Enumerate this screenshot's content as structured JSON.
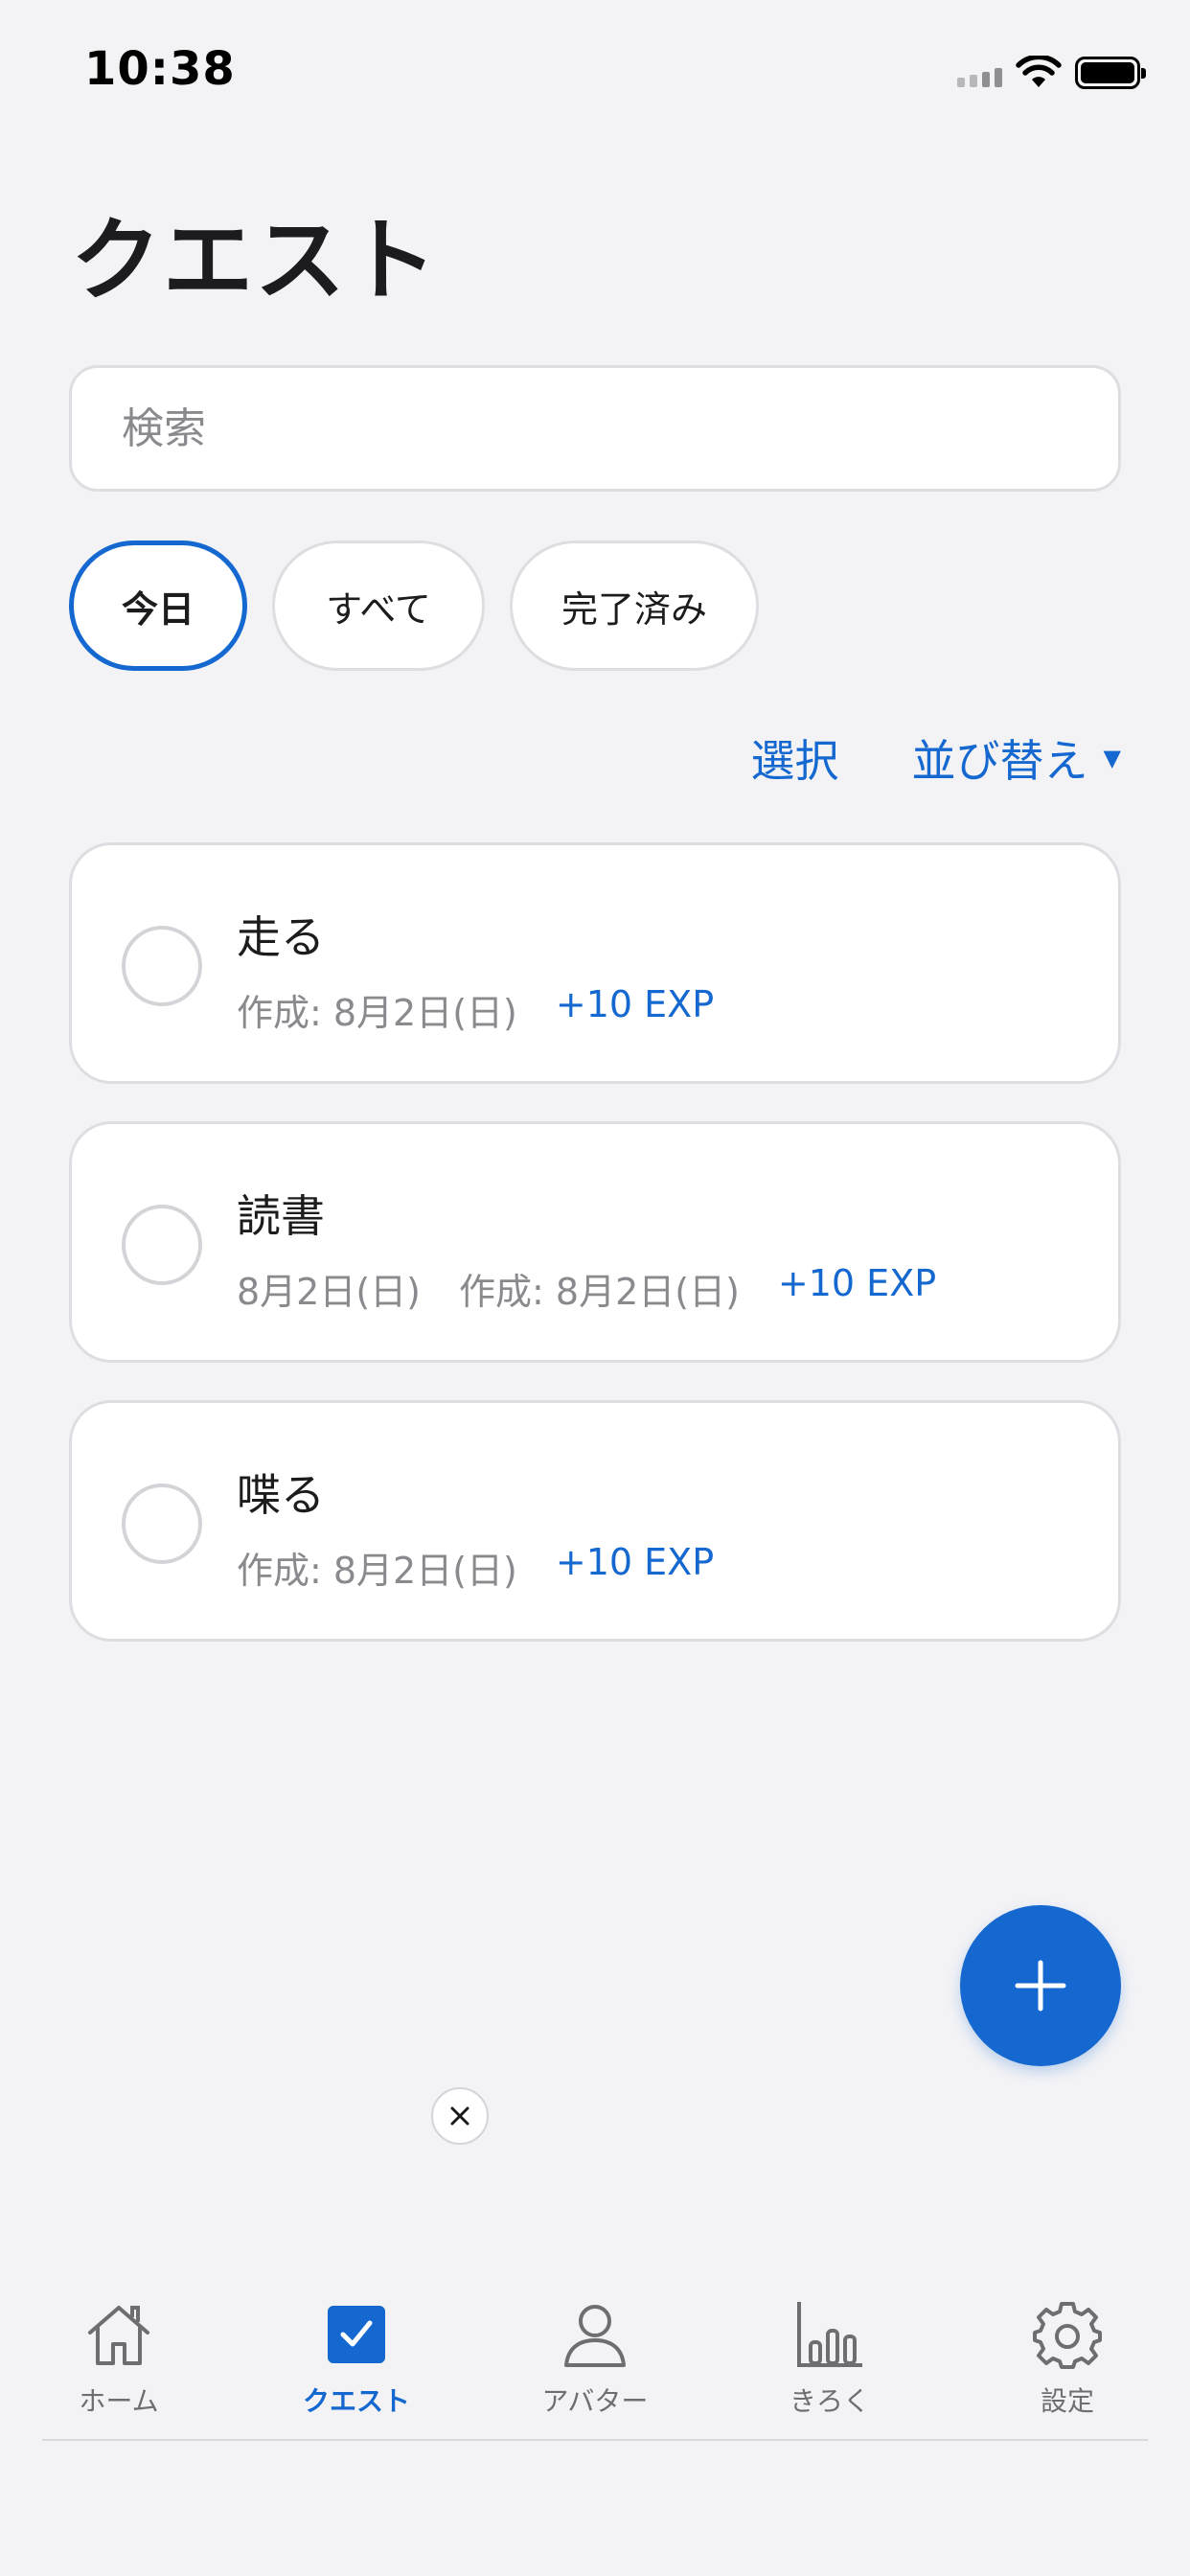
{
  "status_bar": {
    "time": "10:38"
  },
  "page": {
    "title": "クエスト"
  },
  "search": {
    "placeholder": "検索",
    "value": ""
  },
  "filters": [
    {
      "label": "今日",
      "selected": true
    },
    {
      "label": "すべて",
      "selected": false
    },
    {
      "label": "完了済み",
      "selected": false
    }
  ],
  "actions": {
    "select_label": "選択",
    "sort_label": "並び替え"
  },
  "quests": [
    {
      "title": "走る",
      "due": "",
      "created": "作成: 8月2日(日)",
      "exp": "+10 EXP",
      "completed": false
    },
    {
      "title": "読書",
      "due": "8月2日(日)",
      "created": "作成: 8月2日(日)",
      "exp": "+10 EXP",
      "completed": false
    },
    {
      "title": "喋る",
      "due": "",
      "created": "作成: 8月2日(日)",
      "exp": "+10 EXP",
      "completed": false
    }
  ],
  "fab": {
    "icon": "plus-icon"
  },
  "dismiss": {
    "icon": "close-icon"
  },
  "tabs": [
    {
      "label": "ホーム",
      "icon": "home-icon",
      "active": false
    },
    {
      "label": "クエスト",
      "icon": "checkbox-icon",
      "active": true
    },
    {
      "label": "アバター",
      "icon": "person-icon",
      "active": false
    },
    {
      "label": "きろく",
      "icon": "bar-chart-icon",
      "active": false
    },
    {
      "label": "設定",
      "icon": "gear-icon",
      "active": false
    }
  ],
  "colors": {
    "accent": "#1468d0",
    "background": "#f3f3f6",
    "card": "#ffffff",
    "secondary_text": "#8a8a8e"
  }
}
